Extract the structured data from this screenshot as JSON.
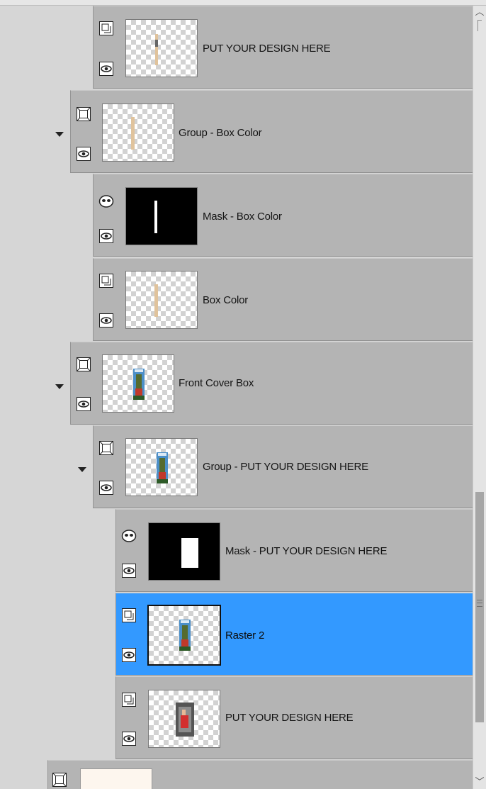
{
  "layers": [
    {
      "name": "PUT YOUR DESIGN HERE",
      "icon": "raster-layer-icon",
      "thumb": "beige-strip"
    },
    {
      "name": "Group - Box Color",
      "icon": "group-layer-icon",
      "thumb": "beige-strip",
      "expanded": true
    },
    {
      "name": "Mask - Box Color",
      "icon": "mask-layer-icon",
      "thumb": "mask-line"
    },
    {
      "name": "Box Color",
      "icon": "raster-layer-icon",
      "thumb": "beige-strip"
    },
    {
      "name": "Front Cover Box",
      "icon": "group-layer-icon",
      "thumb": "cover-image",
      "expanded": true
    },
    {
      "name": "Group - PUT YOUR DESIGN HERE",
      "icon": "group-layer-icon",
      "thumb": "cover-image",
      "expanded": true
    },
    {
      "name": "Mask - PUT YOUR DESIGN HERE",
      "icon": "mask-layer-icon",
      "thumb": "mask-rect"
    },
    {
      "name": "Raster 2",
      "icon": "raster-layer-icon",
      "thumb": "cover-image",
      "selected": true
    },
    {
      "name": "PUT YOUR DESIGN HERE",
      "icon": "raster-layer-icon",
      "thumb": "cover-image-dark"
    },
    {
      "name": "",
      "icon": "group-layer-icon",
      "thumb": "cream-fill"
    }
  ],
  "colors": {
    "selection": "#3399ff",
    "layer_bg": "#b4b4b4",
    "panel_bg": "#d6d6d6",
    "beige": "#e0c39c"
  },
  "scrollbar": {
    "up": "︿",
    "down": "﹀"
  }
}
